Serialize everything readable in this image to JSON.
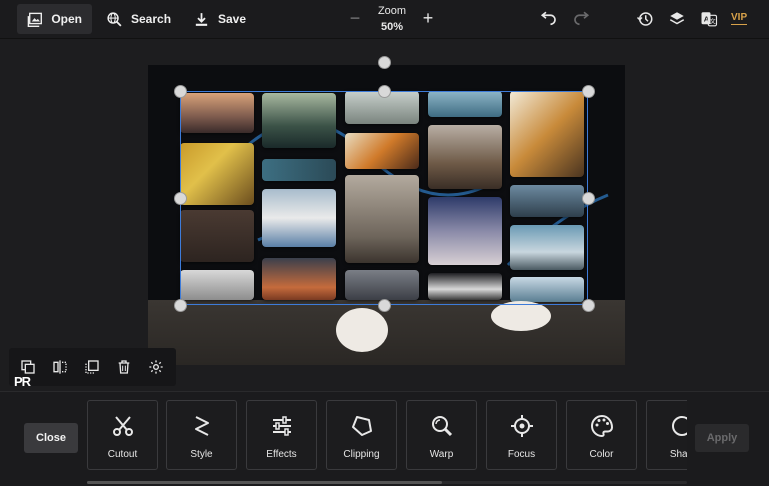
{
  "toolbar": {
    "open_label": "Open",
    "search_label": "Search",
    "save_label": "Save",
    "zoom_label": "Zoom",
    "zoom_value": "50%",
    "vip_label": "VIP",
    "icons": [
      "image-icon",
      "globe-search-icon",
      "download-icon",
      "zoom-out-icon",
      "zoom-in-icon",
      "undo-icon",
      "redo-icon",
      "history-icon",
      "layers-icon",
      "translate-icon"
    ]
  },
  "mini_toolbar": {
    "icons": [
      "duplicate-icon",
      "flip-icon",
      "bring-front-icon",
      "delete-icon",
      "settings-icon"
    ],
    "watermark": "PR"
  },
  "bottom_panel": {
    "close_label": "Close",
    "apply_label": "Apply",
    "tools": [
      {
        "label": "Cutout",
        "icon": "scissors-icon"
      },
      {
        "label": "Style",
        "icon": "style-icon"
      },
      {
        "label": "Effects",
        "icon": "sliders-icon"
      },
      {
        "label": "Clipping",
        "icon": "polygon-icon"
      },
      {
        "label": "Warp",
        "icon": "warp-icon"
      },
      {
        "label": "Focus",
        "icon": "crosshair-icon"
      },
      {
        "label": "Color",
        "icon": "palette-icon"
      },
      {
        "label": "Shad",
        "icon": "shadow-icon"
      }
    ]
  },
  "colors": {
    "accent_selection": "#3d7bd9",
    "vip": "#d8a24a",
    "background": "#1d1d1f"
  }
}
